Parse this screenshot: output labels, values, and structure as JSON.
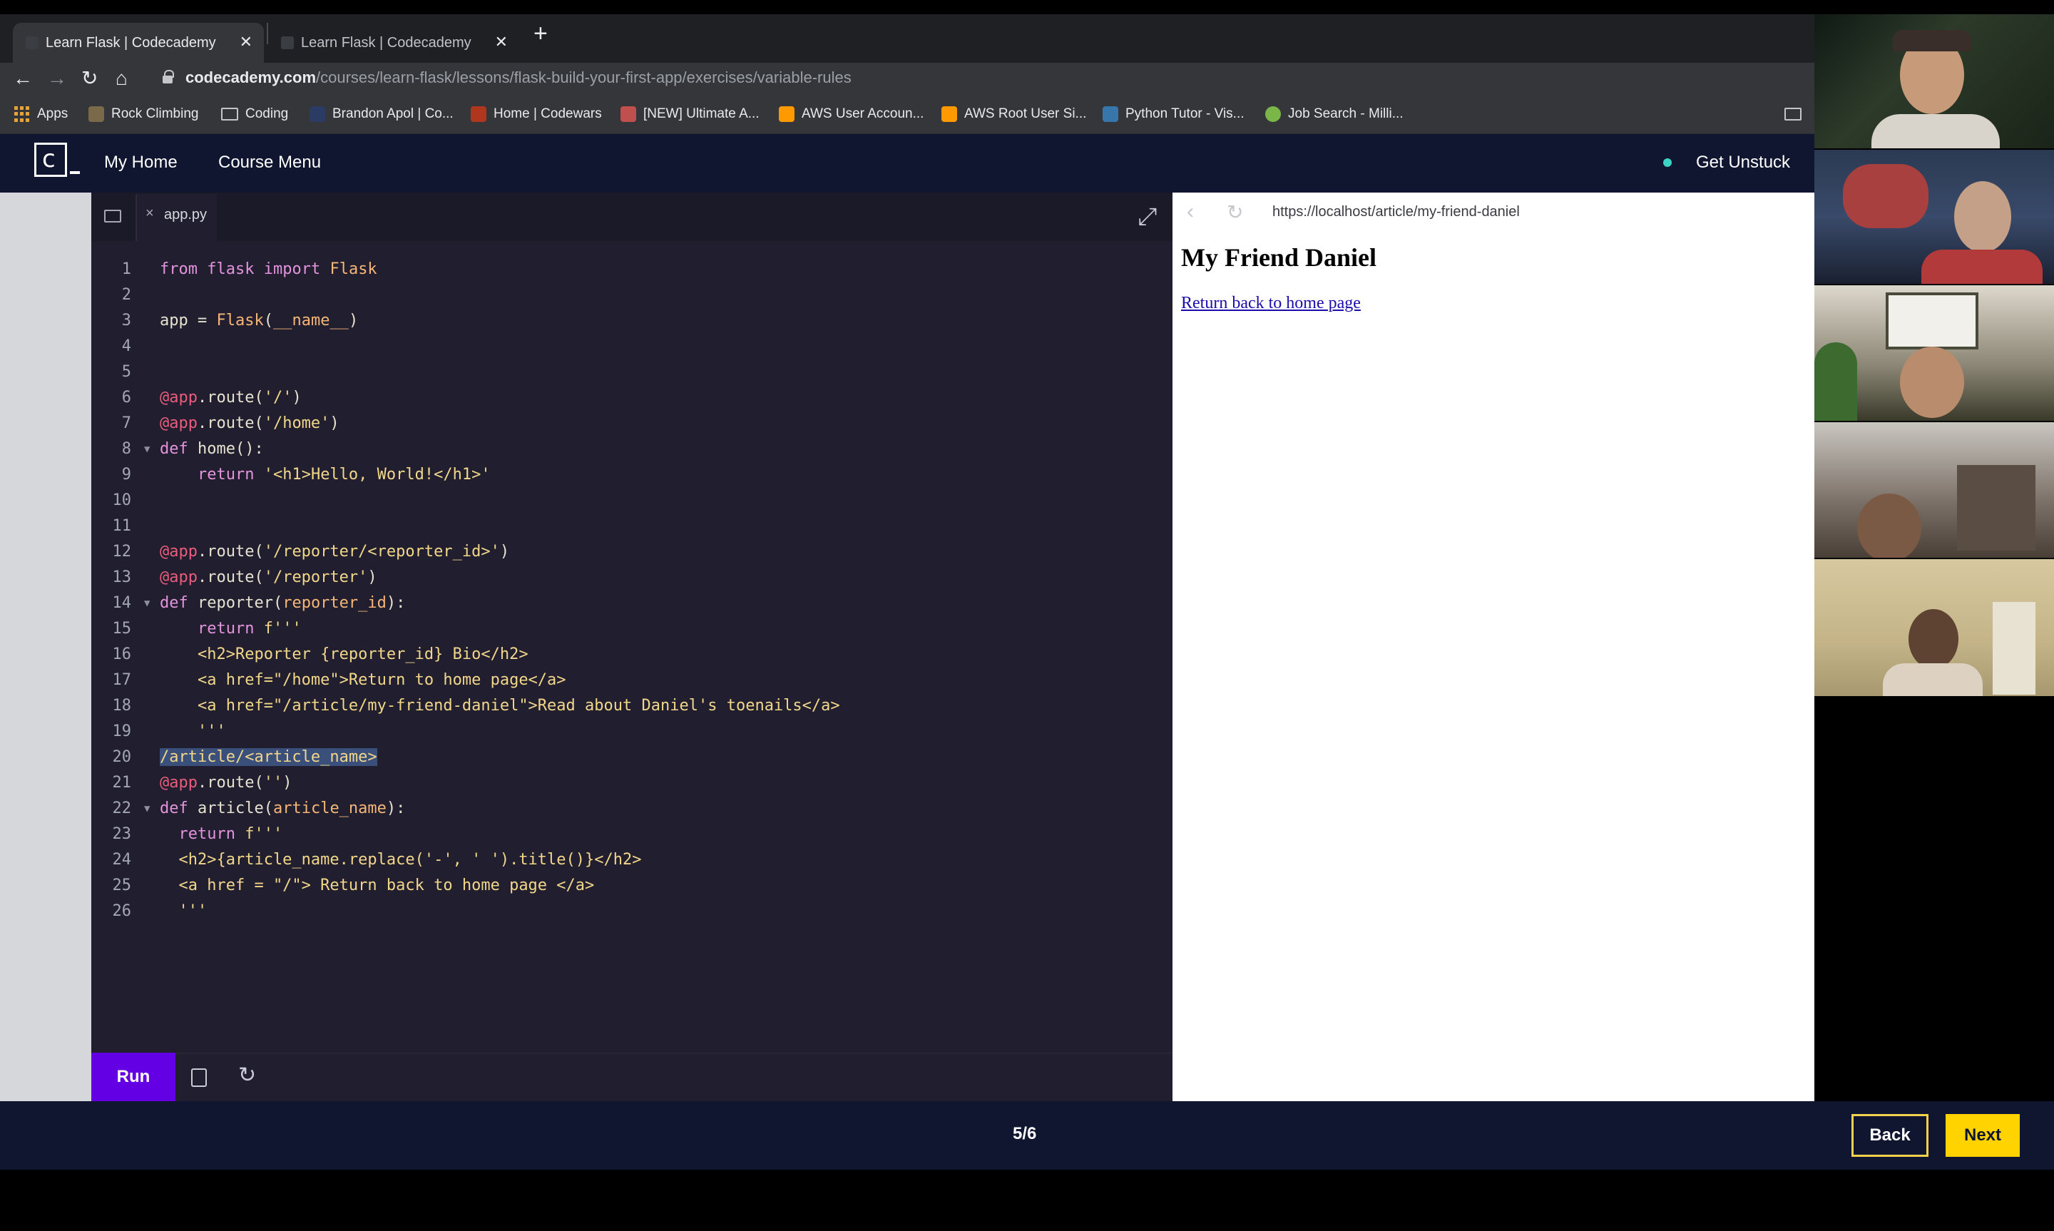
{
  "browser": {
    "tabs": [
      {
        "title": "Learn Flask | Codecademy",
        "active": true
      },
      {
        "title": "Learn Flask | Codecademy",
        "active": false
      }
    ],
    "new_tab": "+",
    "url_host": "codecademy.com",
    "url_path": "/courses/learn-flask/lessons/flask-build-your-first-app/exercises/variable-rules",
    "bookmarks": [
      {
        "label": "Apps"
      },
      {
        "label": "Rock Climbing"
      },
      {
        "label": "Coding"
      },
      {
        "label": "Brandon Apol | Co..."
      },
      {
        "label": "Home | Codewars"
      },
      {
        "label": "[NEW] Ultimate A..."
      },
      {
        "label": "AWS User Accoun..."
      },
      {
        "label": "AWS Root User Si..."
      },
      {
        "label": "Python Tutor - Vis..."
      },
      {
        "label": "Job Search - Milli..."
      }
    ]
  },
  "header": {
    "logo": "c",
    "nav": [
      "My Home",
      "Course Menu"
    ],
    "get_unstuck": "Get Unstuck"
  },
  "editor": {
    "file_tab": "app.py",
    "run_label": "Run",
    "lines": [
      {
        "n": "1",
        "html": "<span class='k'>from</span> <span class='k'>flask</span> <span class='k'>import</span> <span class='f'>Flask</span>"
      },
      {
        "n": "2",
        "html": ""
      },
      {
        "n": "3",
        "html": "app = <span class='f'>Flask</span>(<span class='f'>__name__</span>)"
      },
      {
        "n": "4",
        "html": ""
      },
      {
        "n": "5",
        "html": ""
      },
      {
        "n": "6",
        "html": "<span class='d'>@app</span>.route(<span class='s'>'/'</span>)"
      },
      {
        "n": "7",
        "html": "<span class='d'>@app</span>.route(<span class='s'>'/home'</span>)"
      },
      {
        "n": "8",
        "fold": true,
        "html": "<span class='k'>def</span> home():"
      },
      {
        "n": "9",
        "html": "    <span class='k'>return</span> <span class='s'>'&lt;h1&gt;Hello, World!&lt;/h1&gt;'</span>"
      },
      {
        "n": "10",
        "html": ""
      },
      {
        "n": "11",
        "html": ""
      },
      {
        "n": "12",
        "html": "<span class='d'>@app</span>.route(<span class='s'>'/reporter/&lt;reporter_id&gt;'</span>)"
      },
      {
        "n": "13",
        "html": "<span class='d'>@app</span>.route(<span class='s'>'/reporter'</span>)"
      },
      {
        "n": "14",
        "fold": true,
        "html": "<span class='k'>def</span> reporter(<span class='f'>reporter_id</span>):"
      },
      {
        "n": "15",
        "html": "    <span class='k'>return</span> <span class='s'>f'''</span>"
      },
      {
        "n": "16",
        "html": "<span class='s'>    &lt;h2&gt;Reporter {reporter_id} Bio&lt;/h2&gt;</span>"
      },
      {
        "n": "17",
        "html": "<span class='s'>    &lt;a href=\"/home\"&gt;Return to home page&lt;/a&gt;</span>"
      },
      {
        "n": "18",
        "html": "<span class='s'>    &lt;a href=\"/article/my-friend-daniel\"&gt;Read about Daniel's toenails&lt;/a&gt;</span>"
      },
      {
        "n": "19",
        "html": "<span class='s'>    '''</span>"
      },
      {
        "n": "20",
        "html": "<span class='sel'><span class='s'>/article/&lt;article_name&gt;</span></span>"
      },
      {
        "n": "21",
        "html": "<span class='d'>@app</span>.route(<span class='s'>''</span>)"
      },
      {
        "n": "22",
        "fold": true,
        "html": "<span class='k'>def</span> article(<span class='f'>article_name</span>):"
      },
      {
        "n": "23",
        "html": "  <span class='k'>return</span> <span class='s'>f'''</span>"
      },
      {
        "n": "24",
        "html": "<span class='s'>  &lt;h2&gt;{article_name.replace('-', ' ').title()}&lt;/h2&gt;</span>"
      },
      {
        "n": "25",
        "html": "<span class='s'>  &lt;a href = \"/\"&gt; Return back to home page &lt;/a&gt;</span>"
      },
      {
        "n": "26",
        "html": "<span class='s'>  '''</span>"
      }
    ]
  },
  "preview": {
    "url": "https://localhost/article/my-friend-daniel",
    "heading": "My Friend Daniel",
    "link": "Return back to home page"
  },
  "footer": {
    "progress": "5/6",
    "back_label": "Back",
    "next_label": "Next"
  },
  "colors": {
    "brand_navy": "#10162f",
    "run_purple": "#6400e4",
    "next_yellow": "#ffd300"
  }
}
